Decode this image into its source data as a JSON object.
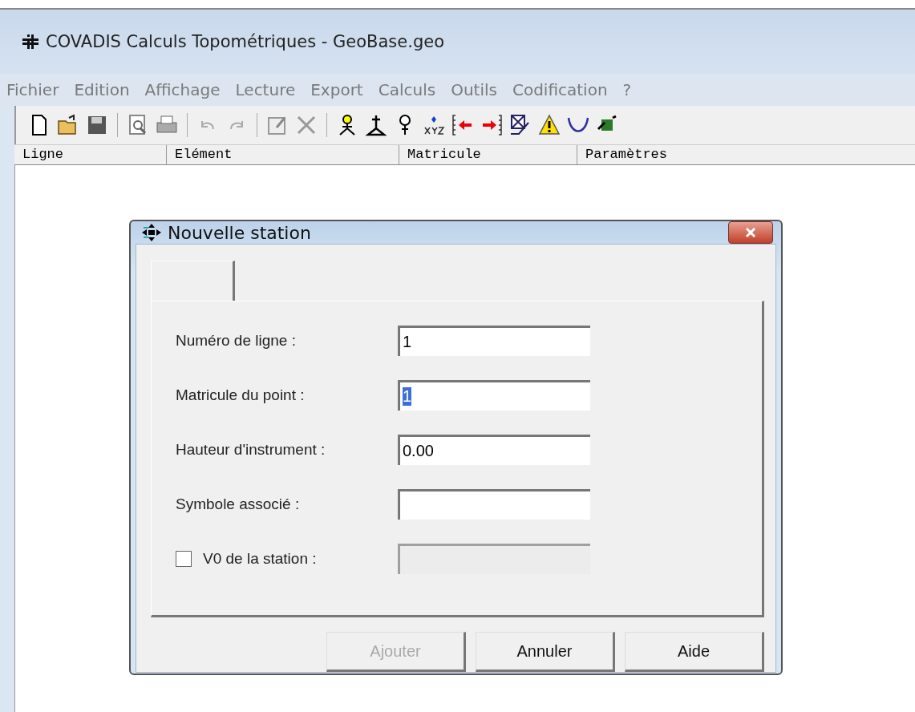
{
  "window": {
    "title": "COVADIS Calculs Topométriques - GeoBase.geo"
  },
  "menu": [
    "Fichier",
    "Edition",
    "Affichage",
    "Lecture",
    "Export",
    "Calculs",
    "Outils",
    "Codification",
    "?"
  ],
  "table": {
    "columns": [
      "Ligne",
      "Elément",
      "Matricule",
      "Paramètres"
    ]
  },
  "dialog": {
    "title": "Nouvelle station",
    "fields": [
      {
        "kind": "text",
        "label": "Numéro de ligne :",
        "value": "1",
        "highlighted": false,
        "disabled": false
      },
      {
        "kind": "text",
        "label": "Matricule du point :",
        "value": "1",
        "highlighted": true,
        "disabled": false
      },
      {
        "kind": "text",
        "label": "Hauteur d'instrument :",
        "value": "0.00",
        "highlighted": false,
        "disabled": false
      },
      {
        "kind": "text",
        "label": "Symbole associé :",
        "disabled": false
      },
      {
        "kind": "checkbox",
        "label": "V0 de la station :",
        "checked": false,
        "disabled": true
      }
    ],
    "buttons": [
      {
        "label": "Ajouter",
        "disabled": true
      },
      {
        "label": "Annuler",
        "disabled": false
      },
      {
        "label": "Aide",
        "disabled": false
      }
    ]
  }
}
